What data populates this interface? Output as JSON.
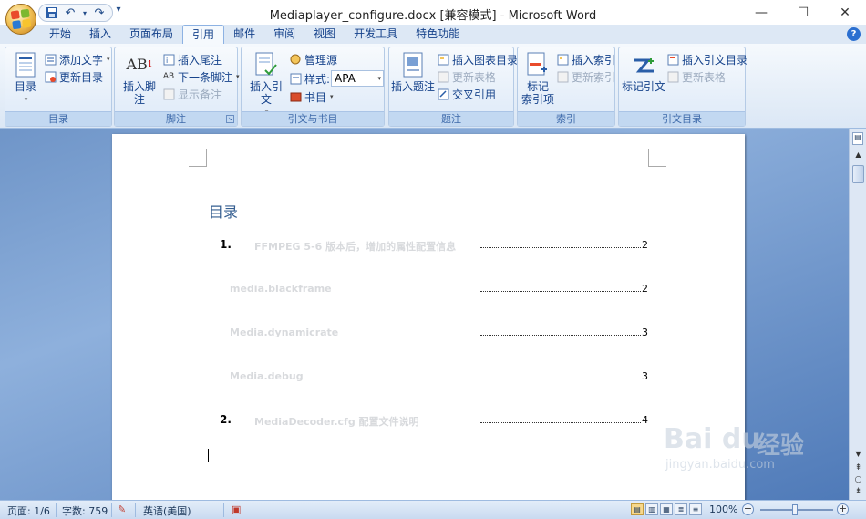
{
  "window": {
    "title": "Mediaplayer_configure.docx [兼容模式] - Microsoft Word",
    "minimize": "—",
    "maximize": "☐",
    "close": "✕"
  },
  "quick_access": {
    "save_icon": "save-icon",
    "undo_icon": "undo-icon",
    "redo_icon": "redo-icon",
    "customize_icon": "chevron-down-icon"
  },
  "tabs": [
    "开始",
    "插入",
    "页面布局",
    "引用",
    "邮件",
    "审阅",
    "视图",
    "开发工具",
    "特色功能"
  ],
  "active_tab": "引用",
  "ribbon": {
    "toc": {
      "label": "目录",
      "toc_button": "目录",
      "add_text": "添加文字",
      "update_toc": "更新目录"
    },
    "footnotes": {
      "label": "脚注",
      "insert_footnote": "插入脚注",
      "insert_endnote": "插入尾注",
      "next_footnote": "下一条脚注",
      "show_notes": "显示备注"
    },
    "citations": {
      "label": "引文与书目",
      "insert_citation": "插入引文",
      "manage_sources": "管理源",
      "style_label": "样式:",
      "style_value": "APA",
      "bibliography": "书目"
    },
    "captions": {
      "label": "题注",
      "insert_caption": "插入题注",
      "insert_table_of_figures": "插入图表目录",
      "update_table": "更新表格",
      "cross_reference": "交叉引用"
    },
    "index": {
      "label": "索引",
      "mark_entry": "标记\n索引项",
      "insert_index": "插入索引",
      "update_index": "更新索引"
    },
    "toa": {
      "label": "引文目录",
      "mark_citation": "标记引文",
      "insert_toa": "插入引文目录",
      "update_table": "更新表格"
    }
  },
  "document": {
    "toc_heading": "目录",
    "entries": [
      {
        "num": "1.",
        "text": "FFMPEG 5-6 版本后，增加的属性配置信息",
        "page": "2"
      },
      {
        "num": "",
        "text": "media.blackframe",
        "page": "2"
      },
      {
        "num": "",
        "text": "Media.dynamicrate",
        "page": "3"
      },
      {
        "num": "",
        "text": "Media.debug",
        "page": "3"
      },
      {
        "num": "2.",
        "text": "MediaDecoder.cfg 配置文件说明",
        "page": "4"
      }
    ]
  },
  "watermark": {
    "logo": "Bai du",
    "jingyan": "经验",
    "url": "jingyan.baidu.com"
  },
  "statusbar": {
    "page": "页面: 1/6",
    "words": "字数: 759",
    "language": "英语(美国)",
    "zoom": "100%"
  }
}
